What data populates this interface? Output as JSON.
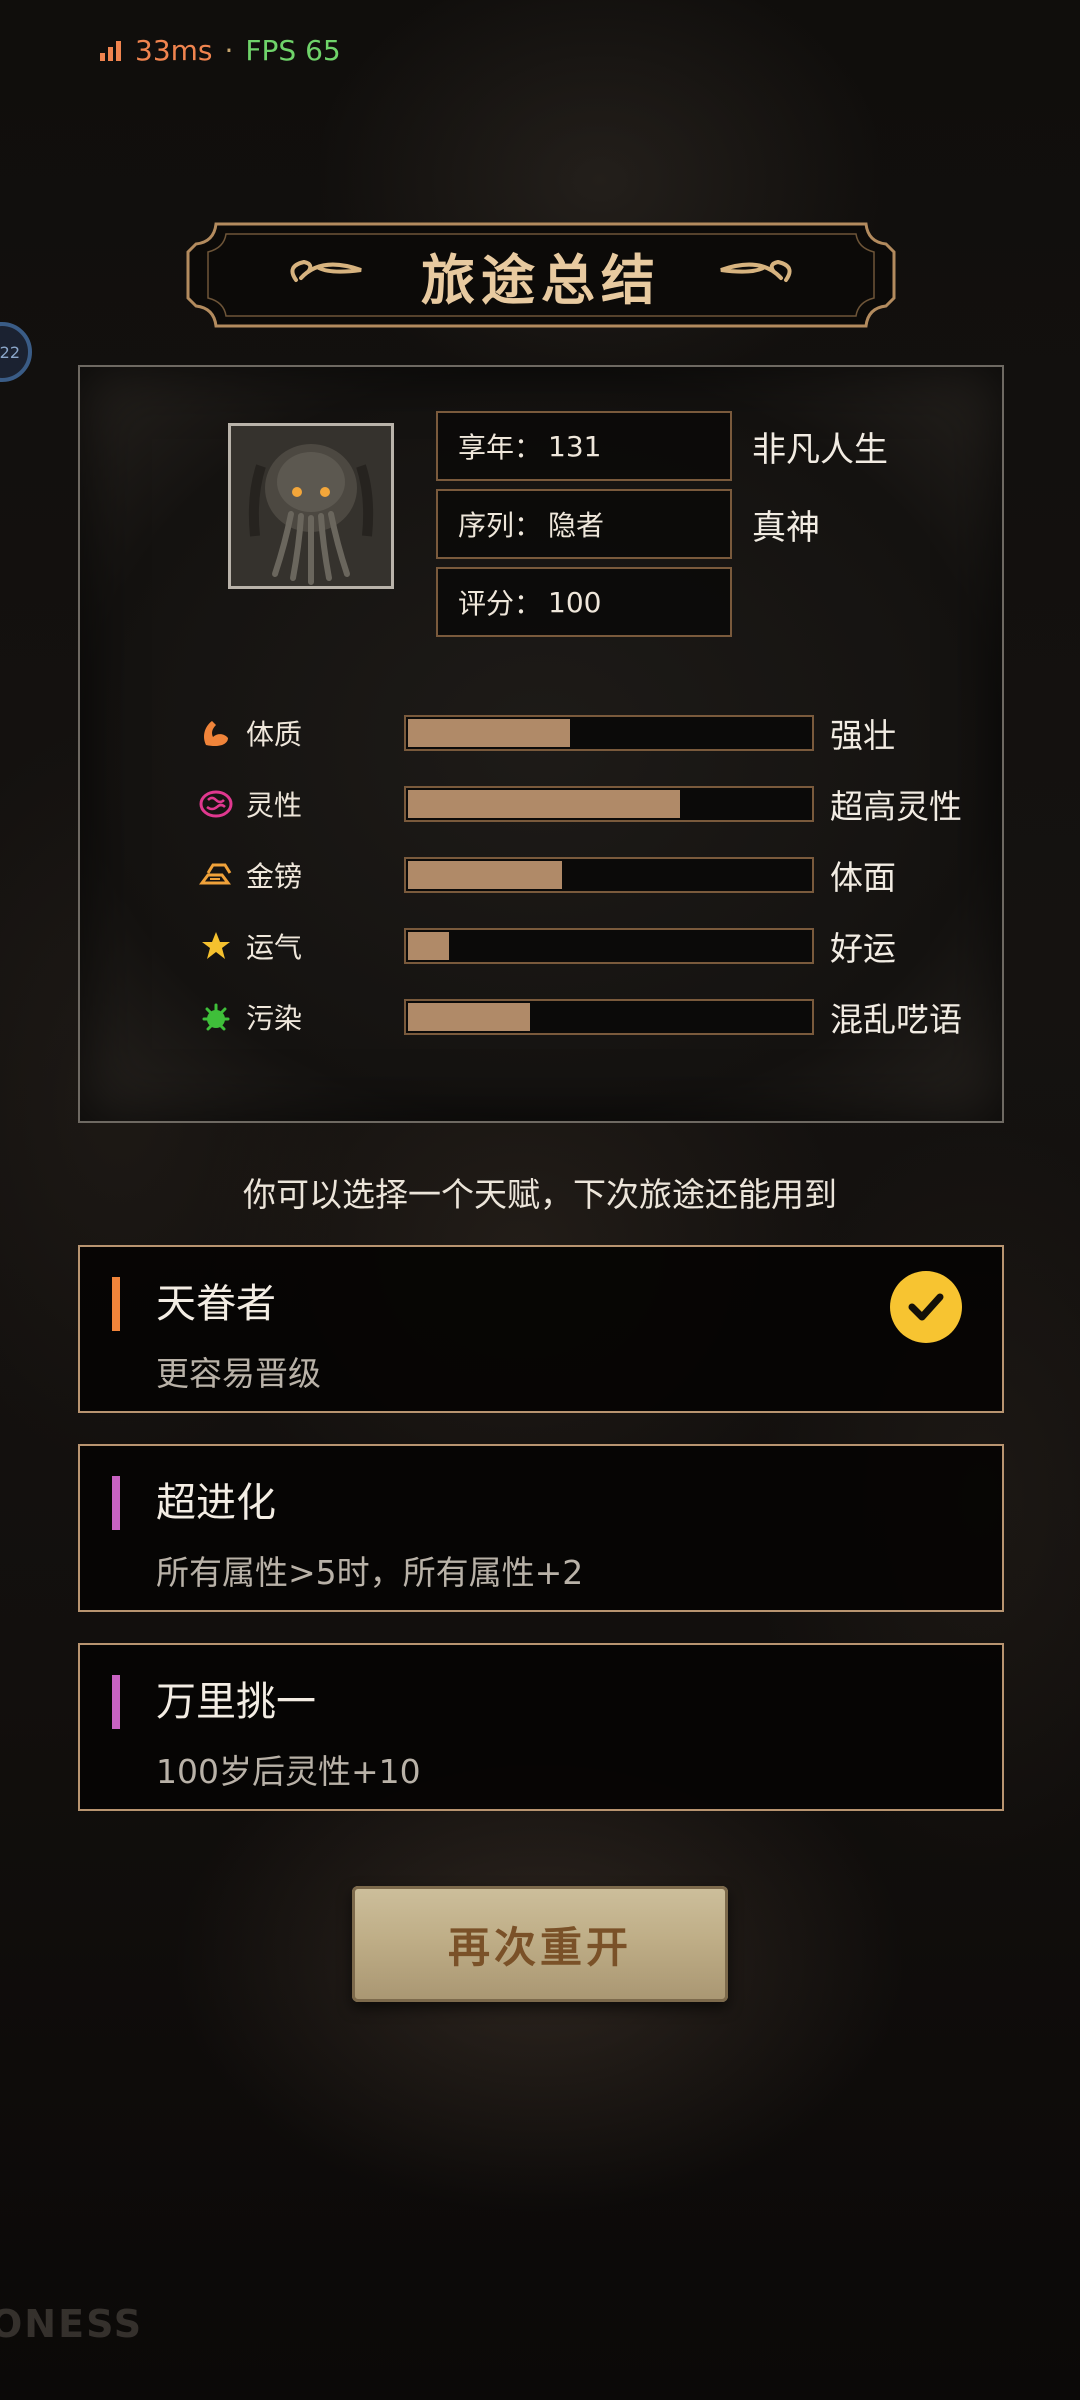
{
  "status_bar": {
    "ping": "33ms",
    "separator": "·",
    "fps": "FPS 65"
  },
  "edge_bubble": {
    "text": "22"
  },
  "banner": {
    "title": "旅途总结"
  },
  "summary": {
    "info": [
      {
        "label": "享年",
        "value": "131",
        "tag": "非凡人生"
      },
      {
        "label": "序列",
        "value": "隐者",
        "tag": "真神"
      },
      {
        "label": "评分",
        "value": "100",
        "tag": ""
      }
    ],
    "stats": [
      {
        "name": "体质",
        "word": "强壮",
        "level": 0.41,
        "icon": "muscle-icon",
        "color": "#f0843a"
      },
      {
        "name": "灵性",
        "word": "超高灵性",
        "level": 0.68,
        "icon": "brain-icon",
        "color": "#e0388f"
      },
      {
        "name": "金镑",
        "word": "体面",
        "level": 0.39,
        "icon": "gold-bars-icon",
        "color": "#f0a23a"
      },
      {
        "name": "运气",
        "word": "好运",
        "level": 0.11,
        "icon": "star-icon",
        "color": "#f5c12e"
      },
      {
        "name": "污染",
        "word": "混乱呓语",
        "level": 0.31,
        "icon": "virus-icon",
        "color": "#3fbf3a"
      }
    ],
    "colon": "："
  },
  "hint": "你可以选择一个天赋，下次旅途还能用到",
  "talents": [
    {
      "name": "天眷者",
      "desc": "更容易晋级",
      "accent": "#f0843a",
      "selected": true
    },
    {
      "name": "超进化",
      "desc": "所有属性>5时，所有属性+2",
      "accent": "#c862c2",
      "selected": false
    },
    {
      "name": "万里挑一",
      "desc": "100岁后灵性+10",
      "accent": "#c862c2",
      "selected": false
    }
  ],
  "restart_button": {
    "label": "再次重开"
  },
  "watermark": "ONESS"
}
